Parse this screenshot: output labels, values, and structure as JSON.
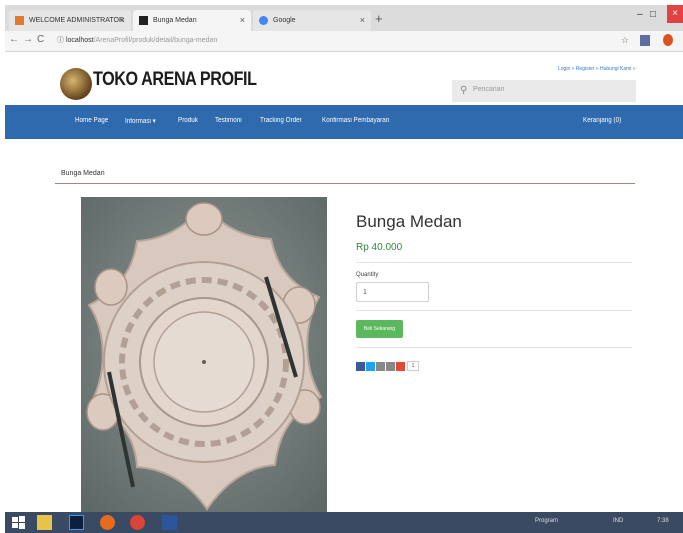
{
  "browser": {
    "tabs": [
      {
        "title": "WELCOME ADMINISTRATOR",
        "close": "×"
      },
      {
        "title": "Bunga Medan",
        "close": "×"
      },
      {
        "title": "Google",
        "close": "×"
      }
    ],
    "new_tab": "+",
    "window_controls": {
      "minimize": "–",
      "maximize": "□",
      "close": "×"
    },
    "nav": {
      "back": "←",
      "forward": "→",
      "reload": "C",
      "info": "ⓘ"
    },
    "url": {
      "host": "localhost",
      "path": "/ArenaProfil/produk/detail/bunga-medan"
    },
    "bookmark_icon": "star-icon",
    "extension_icons": [
      "extension-icon",
      "opera-icon"
    ]
  },
  "site": {
    "logo_text": "TOKO ARENA PROFIL",
    "top_links": "Login » Register » Hubungi Kami »",
    "search_placeholder": "Pencarian",
    "nav": {
      "home": "Home Page",
      "informasi": "Informasi ▾",
      "produk": "Produk",
      "testimoni": "Testimoni",
      "tracking": "Tracking Order",
      "konfirmasi": "Konfirmasi Pembayaran",
      "keranjang": "Keranjang (0)"
    },
    "breadcrumb": "Bunga Medan"
  },
  "product": {
    "name": "Bunga Medan",
    "price": "Rp 40.000",
    "quantity_label": "Quantity",
    "quantity_value": "1",
    "buy_label": "Beli Sekarang",
    "share_buttons": [
      {
        "icon": "facebook-icon",
        "color": "#3b5998"
      },
      {
        "icon": "twitter-icon",
        "color": "#1da1f2"
      },
      {
        "icon": "email-icon",
        "color": "#888888"
      },
      {
        "icon": "print-icon",
        "color": "#888888"
      },
      {
        "icon": "google-plus-icon",
        "color": "#dd4b39"
      }
    ],
    "share_count": "1"
  },
  "taskbar": {
    "tray_text": "Program",
    "tray_lang": "IND",
    "clock": "7:38"
  },
  "colors": {
    "nav_bg": "#2e6aad",
    "price": "#2e8b3a",
    "buy_button": "#5cb85c"
  }
}
